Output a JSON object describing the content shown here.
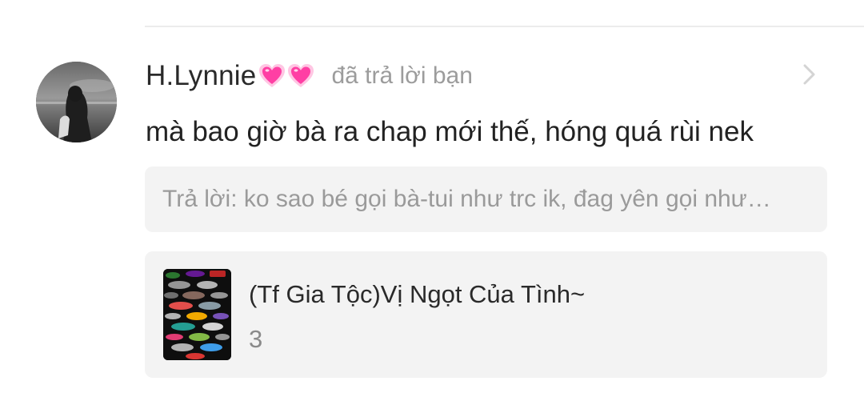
{
  "notification": {
    "username": "H.Lynnie",
    "username_emoji": "growing-heart-icon x2",
    "action_text": "đã trả lời bạn",
    "comment_text": "mà bao giờ bà ra chap mới thế, hóng quá rùi nek",
    "reply_text": "Trả lời: ko sao bé gọi bà-tui như trc ik, đag yên gọi như…",
    "story": {
      "title": "(Tf Gia Tộc)Vị Ngọt Của Tình~",
      "count": "3"
    }
  },
  "colors": {
    "username": "#2a2a2a",
    "secondary_text": "#9c9c9c",
    "box_background": "#f3f3f3",
    "heart_pink": "#ff3fa4"
  },
  "icons": {
    "chevron": "chevron-right-icon",
    "hearts": "pink-heart-icon"
  }
}
